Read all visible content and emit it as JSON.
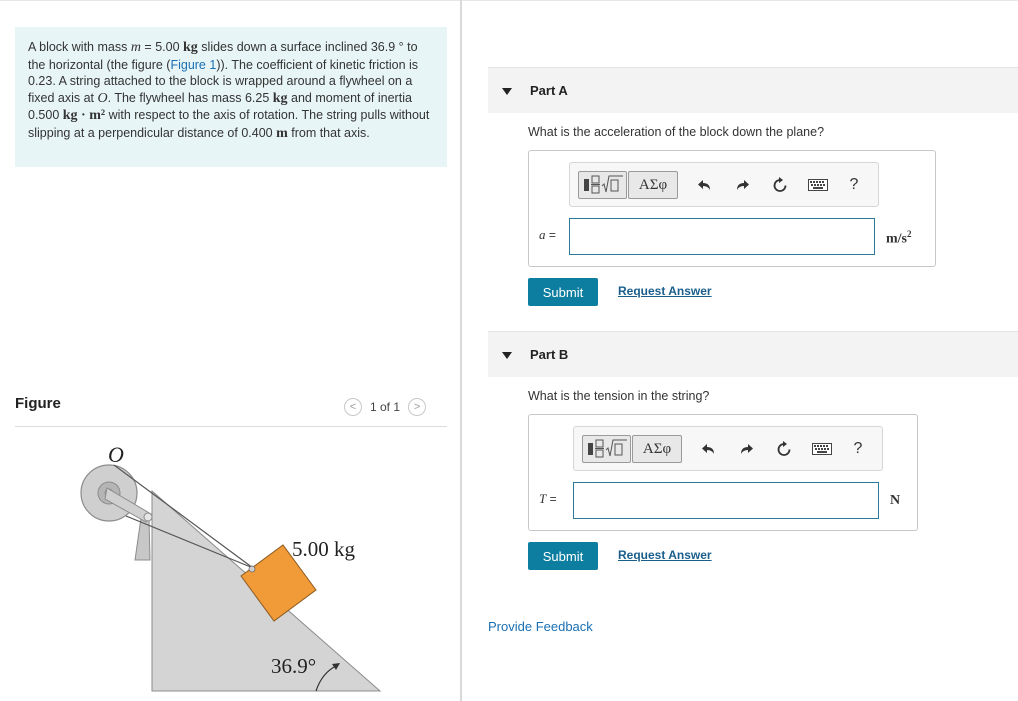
{
  "problem": {
    "text_1": "A block with mass ",
    "var_m": "m",
    "text_2": " = 5.00 ",
    "unit_kg": "kg",
    "text_3": " slides down a surface inclined 36.9 ° to the horizontal (the figure (",
    "figure_link": "Figure 1",
    "text_4": ")). The coefficient of kinetic friction is 0.23. A string attached to the block is wrapped around a flywheel on a fixed axis at ",
    "var_O": "O",
    "text_5": ". The flywheel has mass 6.25 ",
    "unit_kg2": "kg",
    "text_6": " and moment of inertia 0.500 ",
    "unit_kgm2": "kg · m²",
    "text_7": " with respect to the axis of rotation. The string pulls without slipping at a perpendicular distance of 0.400 ",
    "unit_m": "m",
    "text_8": " from that axis."
  },
  "figure": {
    "title": "Figure",
    "pager_text": "1 of 1",
    "prev_symbol": "<",
    "next_symbol": ">",
    "label_axis": "O",
    "label_mass": "5.00 kg",
    "label_angle": "36.9°",
    "colors": {
      "incline": "#d4d4d4",
      "block": "#f19a38",
      "flywheel": "#cfcfcf"
    }
  },
  "toolbar": {
    "greek_label": "ΑΣφ",
    "help_label": "?"
  },
  "partA": {
    "title": "Part A",
    "question": "What is the acceleration of the block down the plane?",
    "var": "a",
    "eq": " =",
    "unit_base": "m/s",
    "unit_exp": "2",
    "input_value": "",
    "submit_label": "Submit",
    "request_label": "Request Answer"
  },
  "partB": {
    "title": "Part B",
    "question": "What is the tension in the string?",
    "var": "T",
    "eq": " =",
    "unit": "N",
    "input_value": "",
    "submit_label": "Submit",
    "request_label": "Request Answer"
  },
  "feedback": {
    "label": "Provide Feedback"
  },
  "colors": {
    "accent": "#0e7ea0",
    "link": "#1a6fb3",
    "problem_bg": "#e8f5f7"
  }
}
